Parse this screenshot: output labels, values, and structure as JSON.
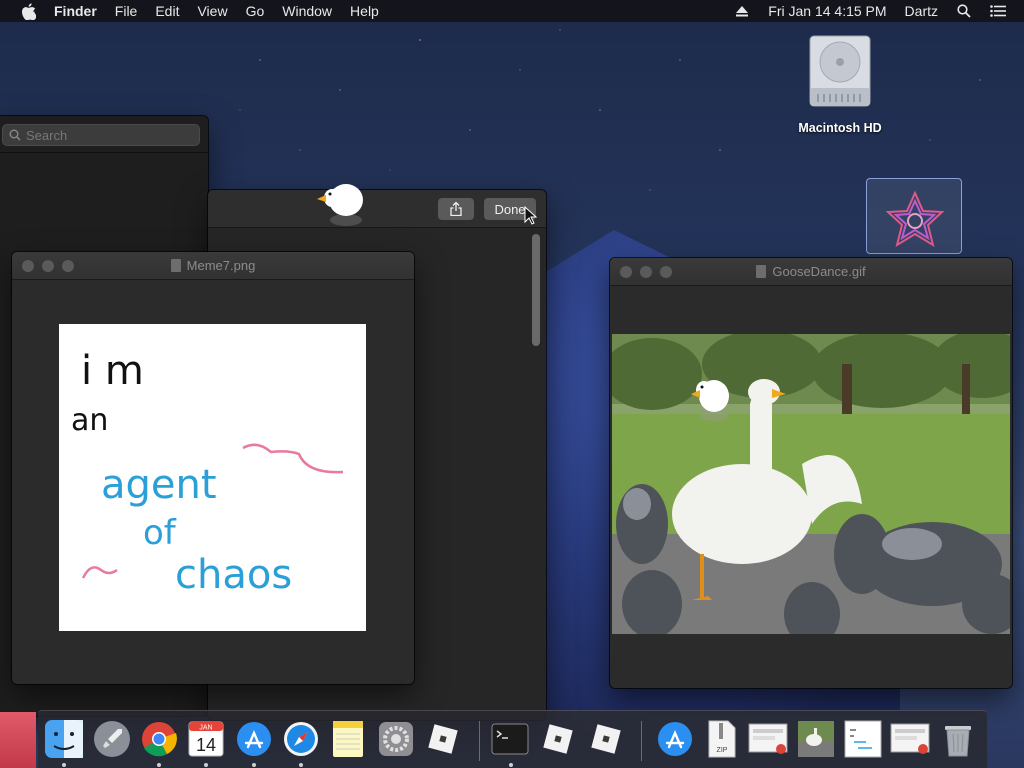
{
  "menubar": {
    "app_name": "Finder",
    "menus": [
      "File",
      "Edit",
      "View",
      "Go",
      "Window",
      "Help"
    ],
    "datetime": "Fri Jan 14  4:15 PM",
    "user": "Dartz"
  },
  "desktop": {
    "hd_label": "Macintosh HD"
  },
  "finder": {
    "search_placeholder": "Search"
  },
  "quicklook": {
    "done_label": "Done"
  },
  "meme_window": {
    "title": "Meme7.png",
    "lines": [
      "i m",
      "an",
      "agent",
      "of",
      "chaos"
    ]
  },
  "goose_window": {
    "title": "GooseDance.gif"
  },
  "dock": {
    "calendar_month": "JAN",
    "calendar_day": "14",
    "zip_label": "ZIP"
  },
  "colors": {
    "handwriting_black": "#111111",
    "handwriting_blue": "#2a9fd8",
    "handwriting_pink": "#e87a9a",
    "goose_beak": "#f2a81d"
  }
}
